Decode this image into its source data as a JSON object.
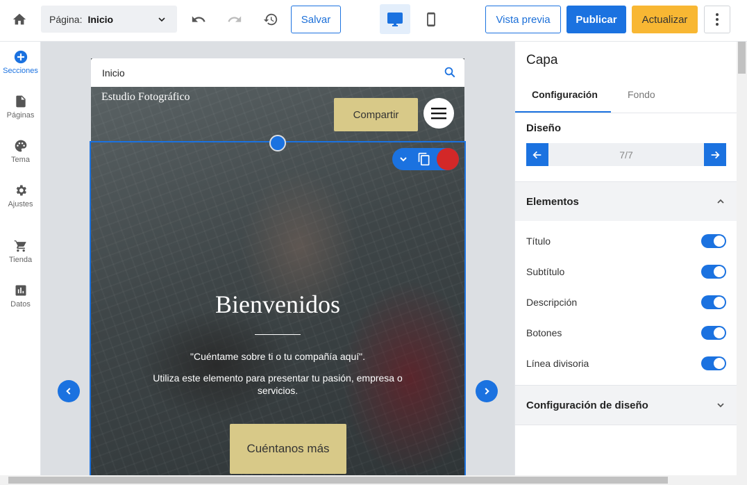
{
  "toolbar": {
    "page_label": "Página:",
    "page_value": "Inicio",
    "save_label": "Salvar",
    "preview_label": "Vista previa",
    "publish_label": "Publicar",
    "update_label": "Actualizar"
  },
  "sidebar": {
    "items": [
      {
        "label": "Secciones",
        "icon": "add-circle-icon"
      },
      {
        "label": "Páginas",
        "icon": "page-icon"
      },
      {
        "label": "Tema",
        "icon": "palette-icon"
      },
      {
        "label": "Ajustes",
        "icon": "gear-icon"
      },
      {
        "label": "Tienda",
        "icon": "cart-icon"
      },
      {
        "label": "Datos",
        "icon": "chart-icon"
      }
    ]
  },
  "preview": {
    "page_bar": "Inicio",
    "brand": "Estudio Fotográfico",
    "share_button": "Compartir",
    "title": "Bienvenidos",
    "quote": "\"Cuéntame sobre ti o tu compañía aquí\".",
    "description": "Utiliza este elemento para presentar tu pasión, empresa o servicios.",
    "cta": "Cuéntanos más"
  },
  "panel": {
    "title": "Capa",
    "tabs": [
      "Configuración",
      "Fondo"
    ],
    "design_label": "Diseño",
    "design_counter": "7/7",
    "elements_label": "Elementos",
    "elements": [
      {
        "label": "Título",
        "on": true
      },
      {
        "label": "Subtítulo",
        "on": true
      },
      {
        "label": "Descripción",
        "on": true
      },
      {
        "label": "Botones",
        "on": true
      },
      {
        "label": "Línea divisoria",
        "on": true
      }
    ],
    "design_settings_label": "Configuración de diseño"
  },
  "colors": {
    "accent": "#1b72e0",
    "update": "#f8b733",
    "hero_button": "#d8c988"
  }
}
